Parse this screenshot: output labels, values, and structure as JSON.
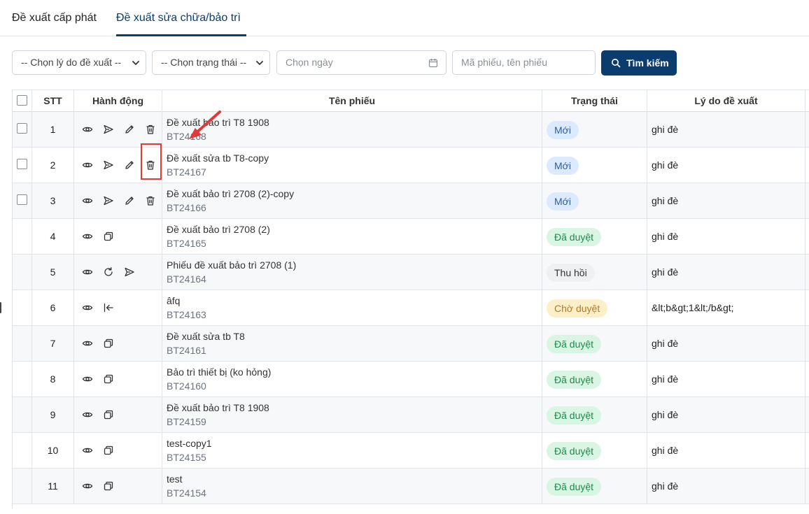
{
  "tabs": [
    {
      "label": "Đề xuất cấp phát",
      "active": false
    },
    {
      "label": "Đề xuất sửa chữa/bảo trì",
      "active": true
    }
  ],
  "filters": {
    "reason_select": "-- Chọn lý do đề xuất --",
    "status_select": "-- Chọn trạng thái --",
    "date_placeholder": "Chọn ngày",
    "search_placeholder": "Mã phiếu, tên phiếu",
    "search_button": "Tìm kiếm"
  },
  "table": {
    "headers": {
      "stt": "STT",
      "actions": "Hành động",
      "name": "Tên phiếu",
      "status": "Trạng thái",
      "reason": "Lý do đề xuất"
    },
    "rows": [
      {
        "stt": "1",
        "title": "Đề xuất bảo trì T8 1908",
        "code": "BT24168",
        "status": "Mới",
        "reason": "ghi đè",
        "checkbox": true,
        "actions": [
          "eye-icon",
          "send-icon",
          "pencil-icon",
          "trash-icon"
        ]
      },
      {
        "stt": "2",
        "title": "Đề xuất sửa tb T8-copy",
        "code": "BT24167",
        "status": "Mới",
        "reason": "ghi đè",
        "checkbox": true,
        "actions": [
          "eye-icon",
          "send-icon",
          "pencil-icon",
          "trash-icon"
        ]
      },
      {
        "stt": "3",
        "title": "Đề xuất bảo trì 2708 (2)-copy",
        "code": "BT24166",
        "status": "Mới",
        "reason": "ghi đè",
        "checkbox": true,
        "actions": [
          "eye-icon",
          "send-icon",
          "pencil-icon",
          "trash-icon"
        ]
      },
      {
        "stt": "4",
        "title": "Đề xuất bảo trì 2708 (2)",
        "code": "BT24165",
        "status": "Đã duyệt",
        "reason": "ghi đè",
        "checkbox": false,
        "actions": [
          "eye-icon",
          "copy-icon"
        ]
      },
      {
        "stt": "5",
        "title": "Phiếu đề xuất bảo trì 2708 (1)",
        "code": "BT24164",
        "status": "Thu hồi",
        "reason": "ghi đè",
        "checkbox": false,
        "actions": [
          "eye-icon",
          "refresh-icon",
          "send-icon"
        ]
      },
      {
        "stt": "6",
        "title": "âfq",
        "code": "BT24163",
        "status": "Chờ duyệt",
        "reason": "&lt;b&gt;1&lt;/b&gt;",
        "checkbox": false,
        "actions": [
          "eye-icon",
          "recall-icon"
        ]
      },
      {
        "stt": "7",
        "title": "Đề xuất sửa tb T8",
        "code": "BT24161",
        "status": "Đã duyệt",
        "reason": "ghi đè",
        "checkbox": false,
        "actions": [
          "eye-icon",
          "copy-icon"
        ]
      },
      {
        "stt": "8",
        "title": "Bảo trì thiết bị (ko hỏng)",
        "code": "BT24160",
        "status": "Đã duyệt",
        "reason": "ghi đè",
        "checkbox": false,
        "actions": [
          "eye-icon",
          "copy-icon"
        ]
      },
      {
        "stt": "9",
        "title": "Đề xuất bảo trì T8 1908",
        "code": "BT24159",
        "status": "Đã duyệt",
        "reason": "ghi đè",
        "checkbox": false,
        "actions": [
          "eye-icon",
          "copy-icon"
        ]
      },
      {
        "stt": "10",
        "title": "test-copy1",
        "code": "BT24155",
        "status": "Đã duyệt",
        "reason": "ghi đè",
        "checkbox": false,
        "actions": [
          "eye-icon",
          "copy-icon"
        ]
      },
      {
        "stt": "11",
        "title": "test",
        "code": "BT24154",
        "status": "Đã duyệt",
        "reason": "ghi đè",
        "checkbox": false,
        "actions": [
          "eye-icon",
          "copy-icon"
        ]
      }
    ]
  },
  "status_colors": {
    "Mới": {
      "bg": "#dbeafe",
      "fg": "#2f5f9e"
    },
    "Đã duyệt": {
      "bg": "#d9f5e3",
      "fg": "#1f8a4c"
    },
    "Thu hồi": {
      "bg": "#eef0f2",
      "fg": "#333333"
    },
    "Chờ duyệt": {
      "bg": "#fdefc8",
      "fg": "#b7791f"
    }
  },
  "colors": {
    "primary": "#0b3c6e",
    "annotation": "#e03a3a"
  }
}
